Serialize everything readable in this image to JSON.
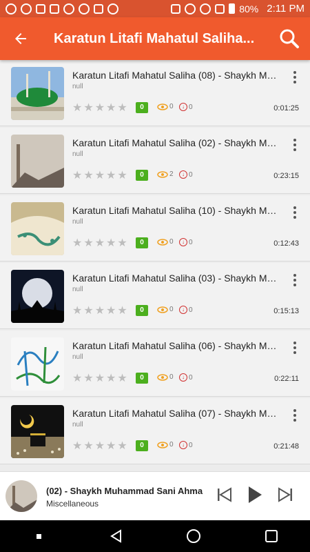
{
  "status": {
    "battery": "80%",
    "time": "2:11 PM"
  },
  "header": {
    "title": "Karatun Litafi Mahatul Saliha...",
    "back_icon": "arrow-back-icon",
    "search_icon": "search-icon",
    "color": "#f05a2d"
  },
  "items": [
    {
      "title": "Karatun Litafi Mahatul Saliha (08) - Shaykh Mu...",
      "sub": "null",
      "badge": "0",
      "views": "0",
      "downloads": "0",
      "duration": "0:01:25"
    },
    {
      "title": "Karatun Litafi Mahatul Saliha (02) - Shaykh Mu...",
      "sub": "null",
      "badge": "0",
      "views": "2",
      "downloads": "0",
      "duration": "0:23:15"
    },
    {
      "title": "Karatun Litafi Mahatul Saliha (10) - Shaykh Mu...",
      "sub": "null",
      "badge": "0",
      "views": "0",
      "downloads": "0",
      "duration": "0:12:43"
    },
    {
      "title": "Karatun Litafi Mahatul Saliha (03) - Shaykh Mu...",
      "sub": "null",
      "badge": "0",
      "views": "0",
      "downloads": "0",
      "duration": "0:15:13"
    },
    {
      "title": "Karatun Litafi Mahatul Saliha (06) - Shaykh Mu...",
      "sub": "null",
      "badge": "0",
      "views": "0",
      "downloads": "0",
      "duration": "0:22:11"
    },
    {
      "title": "Karatun Litafi Mahatul Saliha (07) - Shaykh Mu...",
      "sub": "null",
      "badge": "0",
      "views": "0",
      "downloads": "0",
      "duration": "0:21:48"
    }
  ],
  "player": {
    "title": "(02) - Shaykh Muhammad Sani Ahma",
    "subtitle": "Miscellaneous"
  }
}
